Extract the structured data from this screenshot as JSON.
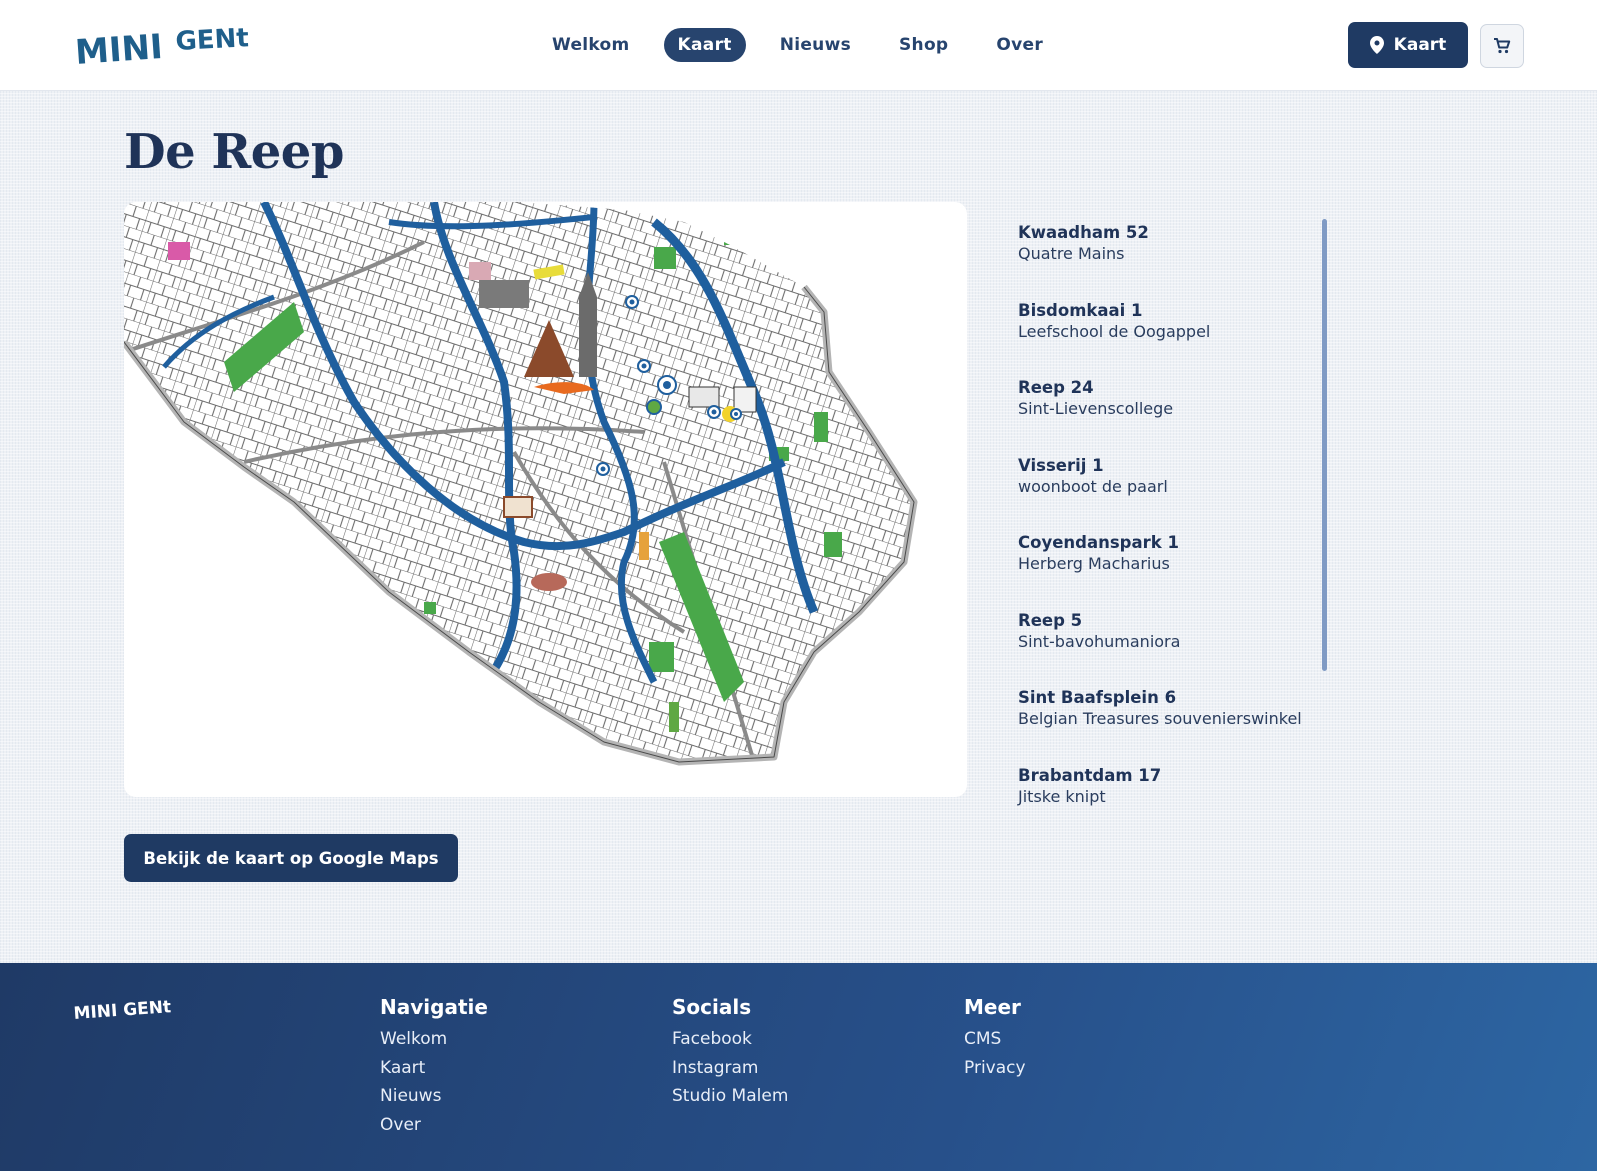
{
  "brand": {
    "logo_text_1": "MINI",
    "logo_text_2": "GENt"
  },
  "nav": {
    "items": [
      {
        "label": "Welkom",
        "active": false
      },
      {
        "label": "Kaart",
        "active": true
      },
      {
        "label": "Nieuws",
        "active": false
      },
      {
        "label": "Shop",
        "active": false
      },
      {
        "label": "Over",
        "active": false
      }
    ]
  },
  "header_actions": {
    "kaart_label": "Kaart",
    "kaart_icon": "map-pin-icon",
    "cart_icon": "cart-icon"
  },
  "page": {
    "title": "De Reep"
  },
  "locations": [
    {
      "address": "Kwaadham 52",
      "name": "Quatre Mains"
    },
    {
      "address": "Bisdomkaai 1",
      "name": "Leefschool de Oogappel"
    },
    {
      "address": "Reep 24",
      "name": "Sint-Lievenscollege"
    },
    {
      "address": "Visserij 1",
      "name": "woonboot de paarl"
    },
    {
      "address": "Coyendanspark 1",
      "name": "Herberg Macharius"
    },
    {
      "address": "Reep 5",
      "name": "Sint-bavohumaniora"
    },
    {
      "address": "Sint Baafsplein 6",
      "name": "Belgian Treasures souvenierswinkel"
    },
    {
      "address": "Brabantdam 17",
      "name": "Jitske knipt"
    }
  ],
  "maps_button": {
    "label": "Bekijk de kaart op Google Maps"
  },
  "footer": {
    "logo_text": "MINI GENt",
    "columns": [
      {
        "title": "Navigatie",
        "links": [
          "Welkom",
          "Kaart",
          "Nieuws",
          "Over"
        ]
      },
      {
        "title": "Socials",
        "links": [
          "Facebook",
          "Instagram",
          "Studio Malem"
        ]
      },
      {
        "title": "Meer",
        "links": [
          "CMS",
          "Privacy"
        ]
      }
    ]
  },
  "colors": {
    "brand_navy": "#1f3a63",
    "canal_blue": "#1f5f9e",
    "park_green": "#49a84a",
    "map_outline": "#b4b4b4"
  }
}
